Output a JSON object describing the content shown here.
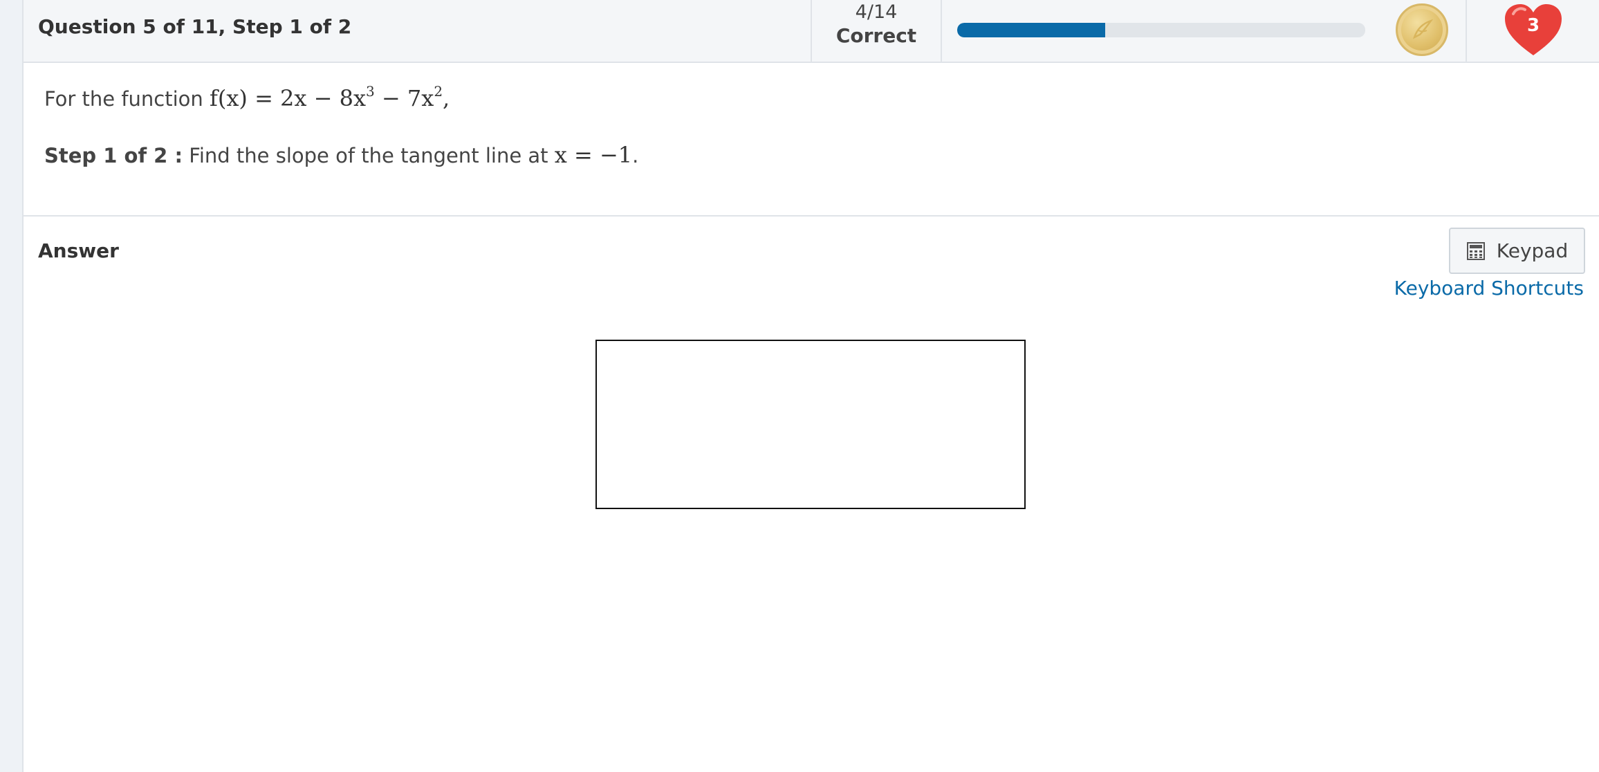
{
  "header": {
    "question_title": "Question 5 of 11, Step 1 of 2",
    "score_count": "4/14",
    "score_label": "Correct",
    "progress_fraction": 0.3625,
    "progress_color": "#0a6aa8",
    "coin_icon": "coin-icon",
    "lives_count": "3",
    "heart_color": "#e8403a"
  },
  "question": {
    "intro_text": "For the function",
    "function": {
      "lhs": "f(x)",
      "eq": "=",
      "t1": "2x",
      "op1": "−",
      "t2_base": "8x",
      "t2_exp": "3",
      "op2": "−",
      "t3_base": "7x",
      "t3_exp": "2",
      "trail": ","
    },
    "step_label": "Step 1 of 2 :",
    "step_text": "Find the slope of the tangent line at",
    "step_math": "x = −1",
    "step_trail": "."
  },
  "answer": {
    "label": "Answer",
    "keypad_label": "Keypad",
    "keypad_icon": "calculator-icon",
    "shortcuts_label": "Keyboard Shortcuts",
    "input_value": ""
  }
}
